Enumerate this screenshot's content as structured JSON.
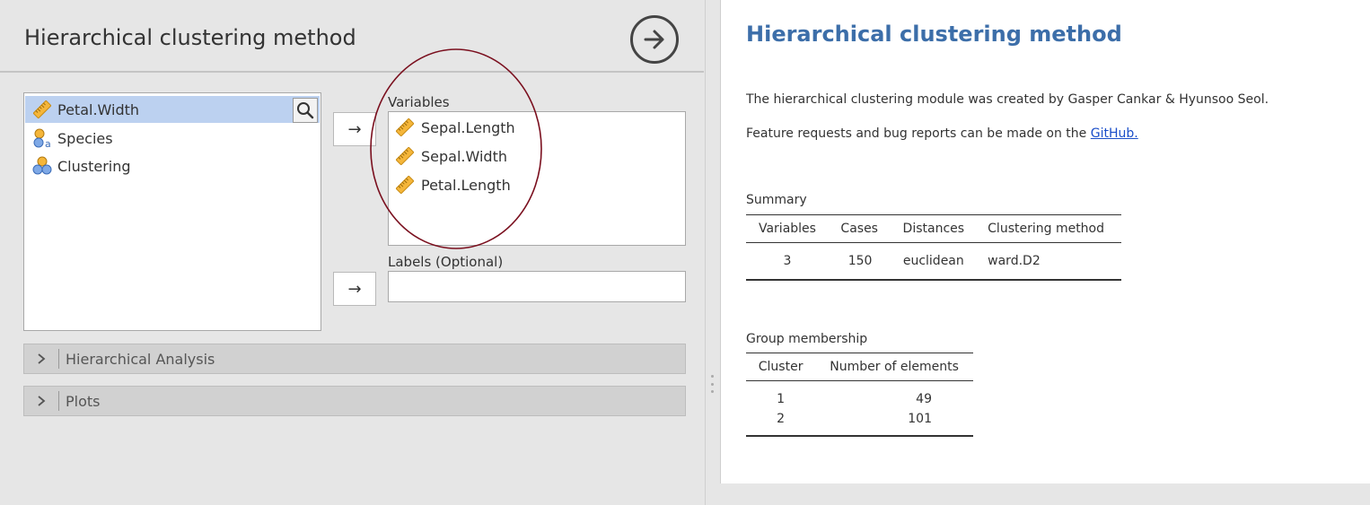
{
  "options": {
    "title": "Hierarchical clustering method",
    "available_vars": [
      {
        "name": "Petal.Width",
        "icon": "scale-ruler-icon",
        "selected": true
      },
      {
        "name": "Species",
        "icon": "nominal-text-icon",
        "selected": false
      },
      {
        "name": "Clustering",
        "icon": "nominal-icon",
        "selected": false
      }
    ],
    "variables_label": "Variables",
    "variables": [
      {
        "name": "Sepal.Length",
        "icon": "scale-ruler-icon"
      },
      {
        "name": "Sepal.Width",
        "icon": "scale-ruler-icon"
      },
      {
        "name": "Petal.Length",
        "icon": "scale-ruler-icon"
      }
    ],
    "labels_label": "Labels (Optional)",
    "labels_value": "",
    "arrow_glyph": "→",
    "sections": [
      "Hierarchical Analysis",
      "Plots"
    ]
  },
  "results": {
    "title": "Hierarchical clustering method",
    "intro": "The hierarchical clustering module was created by Gasper Cankar & Hyunsoo Seol.",
    "feature_prefix": "Feature requests and bug reports can be made on the ",
    "feature_link": "GitHub.",
    "summary": {
      "caption": "Summary",
      "headers": [
        "Variables",
        "Cases",
        "Distances",
        "Clustering method"
      ],
      "rows": [
        [
          "3",
          "150",
          "euclidean",
          "ward.D2"
        ]
      ]
    },
    "groups": {
      "caption": "Group membership",
      "headers": [
        "Cluster",
        "Number of elements"
      ],
      "rows": [
        [
          "1",
          "49"
        ],
        [
          "2",
          "101"
        ]
      ]
    }
  },
  "colors": {
    "accent_title": "#3c6ea9",
    "selection": "#bcd1f0",
    "annotation_circle": "#7a0f1e"
  }
}
